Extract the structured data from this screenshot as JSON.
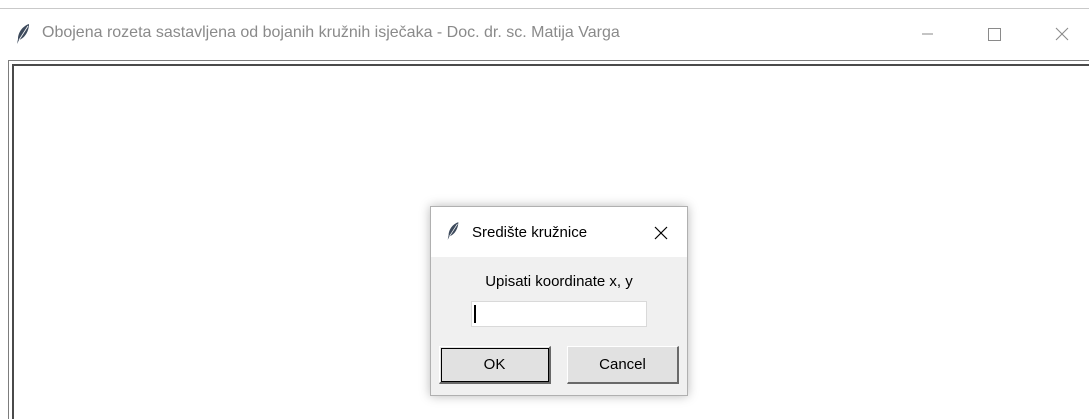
{
  "window": {
    "title": "Obojena rozeta sastavljena od bojanih kružnih isječaka - Doc. dr. sc. Matija Varga",
    "icon": "feather-icon",
    "controls": [
      "minimize-icon",
      "maximize-icon",
      "close-icon"
    ]
  },
  "dialog": {
    "title": "Središte kružnice",
    "icon": "feather-icon",
    "prompt": "Upisati koordinate x, y",
    "input_value": "",
    "ok_label": "OK",
    "cancel_label": "Cancel"
  },
  "colors": {
    "title_text": "#8a8a8a",
    "dialog_bg": "#f0f0f0",
    "button_bg": "#e1e1e1"
  }
}
